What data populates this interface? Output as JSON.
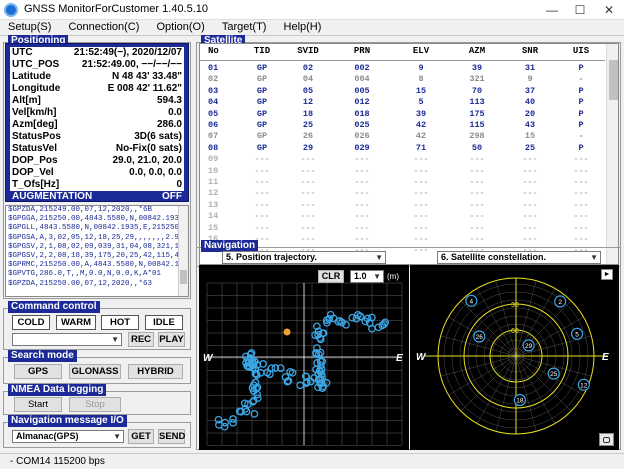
{
  "window": {
    "title": "GNSS MonitorForCustomer 1.40.5.10",
    "minimize": "—",
    "maximize": "☐",
    "close": "✕"
  },
  "menu": [
    "Setup(S)",
    "Connection(C)",
    "Option(O)",
    "Target(T)",
    "Help(H)"
  ],
  "positioning": {
    "title": "Positioning",
    "rows": [
      {
        "k": "UTC",
        "v": "21:52:49(−), 2020/12/07"
      },
      {
        "k": "UTC_POS",
        "v": "21:52:49.00, −−/−−/−−"
      },
      {
        "k": "Latitude",
        "v": "N  48 43' 33.48\""
      },
      {
        "k": "Longitude",
        "v": "E 008 42' 11.62\""
      },
      {
        "k": "Alt[m]",
        "v": "594.3"
      },
      {
        "k": "Vel[km/h]",
        "v": "0.0"
      },
      {
        "k": "Azm[deg]",
        "v": "286.0"
      },
      {
        "k": "StatusPos",
        "v": "3D(6 sats)"
      },
      {
        "k": "StatusVel",
        "v": "No-Fix(0 sats)"
      },
      {
        "k": "DOP_Pos",
        "v": "29.0, 21.0, 20.0"
      },
      {
        "k": "DOP_Vel",
        "v": "0.0, 0.0, 0.0"
      },
      {
        "k": "T_Ofs[Hz]",
        "v": "0"
      },
      {
        "k": "AUGMENTATION",
        "v": "OFF"
      }
    ]
  },
  "nmea_lines": [
    "$GPZDA,215249.00,07,12,2020,,*6B",
    "$GPGGA,215250.00,4843.5580,N,00842.1935,E,1,06,2.1",
    "$GPGLL,4843.5580,N,00842.1935,E,215250.00,A,A*6B",
    "$GPGSA,A,3,02,05,12,18,25,29,,,,,,,2.9,2.1,2.0,1*24",
    "$GPGSV,2,1,08,02,09,039,31,04,08,321,13,05,15,070,37",
    "$GPGSV,2,2,08,18,39,175,20,25,42,115,43,26,42,298,16",
    "$GPRMC,215250.00,A,4843.5580,N,00842.1935,E,0.0,2",
    "$GPVTG,286.0,T,,M,0.0,N,0.0,K,A*01",
    "$GPZDA,215250.00,07,12,2020,,*63"
  ],
  "command_control": {
    "title": "Command control",
    "cold": "COLD",
    "warm": "WARM",
    "hot": "HOT",
    "idle": "IDLE",
    "rec": "REC",
    "play": "PLAY",
    "combo_value": ""
  },
  "search_mode": {
    "title": "Search mode",
    "gps": "GPS",
    "glonass": "GLONASS",
    "hybrid": "HYBRID"
  },
  "nmea_logging": {
    "title": "NMEA Data logging",
    "start": "Start",
    "stop": "Stop"
  },
  "nav_message": {
    "title": "Navigation message I/O",
    "selected": "Almanac(GPS)",
    "get": "GET",
    "send": "SEND"
  },
  "satellite": {
    "title": "Satellite",
    "headers": [
      "No",
      "TID",
      "SVID",
      "PRN",
      "ELV",
      "AZM",
      "SNR",
      "UIS"
    ],
    "rows": [
      {
        "no": "01",
        "tid": "GP",
        "svid": "02",
        "prn": "002",
        "elv": "9",
        "azm": "39",
        "snr": "31",
        "uis": "P",
        "dim": false
      },
      {
        "no": "02",
        "tid": "GP",
        "svid": "04",
        "prn": "004",
        "elv": "8",
        "azm": "321",
        "snr": "9",
        "uis": "-",
        "dim": true
      },
      {
        "no": "03",
        "tid": "GP",
        "svid": "05",
        "prn": "005",
        "elv": "15",
        "azm": "70",
        "snr": "37",
        "uis": "P",
        "dim": false
      },
      {
        "no": "04",
        "tid": "GP",
        "svid": "12",
        "prn": "012",
        "elv": "5",
        "azm": "113",
        "snr": "40",
        "uis": "P",
        "dim": false
      },
      {
        "no": "05",
        "tid": "GP",
        "svid": "18",
        "prn": "018",
        "elv": "39",
        "azm": "175",
        "snr": "20",
        "uis": "P",
        "dim": false
      },
      {
        "no": "06",
        "tid": "GP",
        "svid": "25",
        "prn": "025",
        "elv": "42",
        "azm": "115",
        "snr": "43",
        "uis": "P",
        "dim": false
      },
      {
        "no": "07",
        "tid": "GP",
        "svid": "26",
        "prn": "026",
        "elv": "42",
        "azm": "298",
        "snr": "15",
        "uis": "-",
        "dim": true
      },
      {
        "no": "08",
        "tid": "GP",
        "svid": "29",
        "prn": "029",
        "elv": "71",
        "azm": "50",
        "snr": "25",
        "uis": "P",
        "dim": false
      },
      {
        "no": "09"
      },
      {
        "no": "10"
      },
      {
        "no": "11"
      },
      {
        "no": "12"
      },
      {
        "no": "13"
      },
      {
        "no": "14"
      },
      {
        "no": "15"
      },
      {
        "no": "16"
      },
      {
        "no": "17"
      }
    ],
    "empty_mark": "---"
  },
  "navigation": {
    "title": "Navigation",
    "left_select": "5. Position trajectory.",
    "right_select": "6. Satellite constellation.",
    "clr": "CLR",
    "scale": "1.0",
    "unit": "(m)",
    "west": "W",
    "east": "E",
    "sky_labels": [
      "30",
      "60"
    ],
    "sats": [
      {
        "prn": "2",
        "elv": 9,
        "azm": 39
      },
      {
        "prn": "4",
        "elv": 8,
        "azm": 321
      },
      {
        "prn": "5",
        "elv": 15,
        "azm": 70
      },
      {
        "prn": "12",
        "elv": 5,
        "azm": 113
      },
      {
        "prn": "18",
        "elv": 39,
        "azm": 175
      },
      {
        "prn": "25",
        "elv": 42,
        "azm": 115
      },
      {
        "prn": "26",
        "elv": 42,
        "azm": 298
      },
      {
        "prn": "29",
        "elv": 71,
        "azm": 50
      }
    ]
  },
  "statusbar": "- COM14 115200 bps",
  "colors": {
    "panel": "#1b2a97",
    "nav_bg": "#000000",
    "trajectory": "#3aa6e6",
    "grid": "#ffffff",
    "sky_ring": "#e8e020"
  }
}
